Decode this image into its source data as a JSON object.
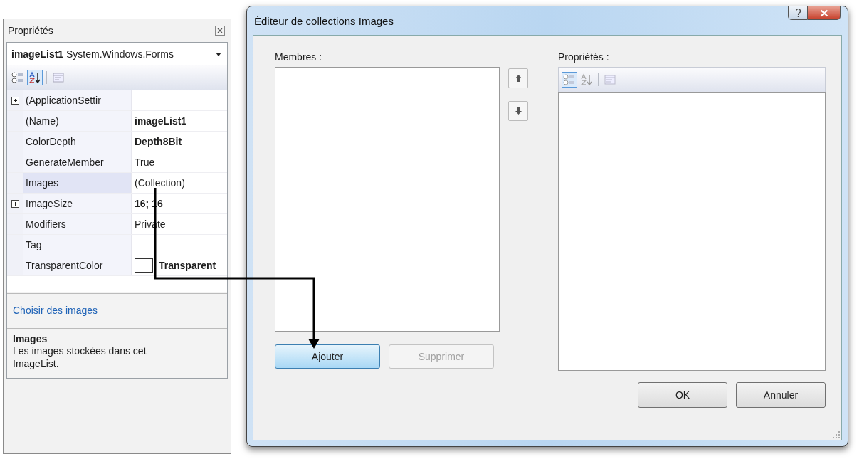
{
  "properties_panel": {
    "title": "Propriétés",
    "object": {
      "name": "imageList1",
      "type": "System.Windows.Forms"
    },
    "toolbar": [
      {
        "selected": false
      },
      {
        "selected": true
      },
      {
        "selected": false
      }
    ],
    "rows": [
      {
        "name": "(ApplicationSettir",
        "expandable": true,
        "selected": false,
        "kind": "text"
      },
      {
        "name": "(Name)",
        "value": "imageList1",
        "expandable": false,
        "bold": true,
        "selected": false,
        "kind": "text"
      },
      {
        "name": "ColorDepth",
        "value": "Depth8Bit",
        "expandable": false,
        "bold": true,
        "selected": false,
        "kind": "text"
      },
      {
        "name": "GenerateMember",
        "value": "True",
        "expandable": false,
        "bold": false,
        "selected": false,
        "kind": "text"
      },
      {
        "name": "Images",
        "value": "(Collection)",
        "expandable": false,
        "bold": false,
        "selected": true,
        "kind": "text"
      },
      {
        "name": "ImageSize",
        "value": "16; 16",
        "expandable": true,
        "bold": true,
        "selected": false,
        "kind": "text"
      },
      {
        "name": "Modifiers",
        "value": "Private",
        "expandable": false,
        "bold": false,
        "selected": false,
        "kind": "text"
      },
      {
        "name": "Tag",
        "expandable": false,
        "selected": false,
        "kind": "text"
      },
      {
        "name": "TransparentColor",
        "value": "Transparent",
        "expandable": false,
        "bold": true,
        "selected": false,
        "kind": "color"
      }
    ],
    "link": "Choisir des images",
    "description": {
      "title": "Images",
      "text": "Les images stockées dans cet ImageList."
    }
  },
  "dialog": {
    "title": "Éditeur de collections Images",
    "members_label": "Membres :",
    "properties_label": "Propriétés :",
    "toolbar": [
      {
        "selected": true
      },
      {
        "selected": false
      },
      {
        "selected": false
      }
    ],
    "buttons": [
      {
        "label": "Ajouter",
        "disabled": false,
        "hot": true
      },
      {
        "label": "Supprimer",
        "disabled": true,
        "hot": false
      }
    ],
    "footer_buttons": [
      {
        "label": "OK"
      },
      {
        "label": "Annuler"
      }
    ]
  }
}
